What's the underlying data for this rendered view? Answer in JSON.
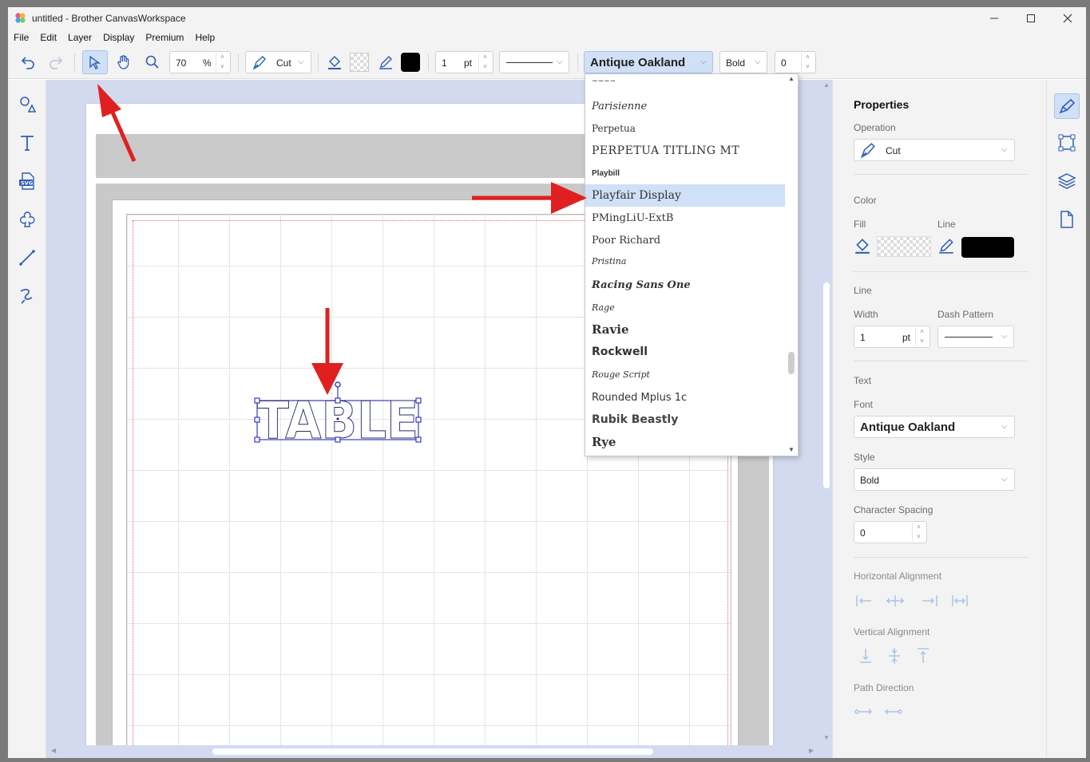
{
  "window": {
    "title": "untitled - Brother CanvasWorkspace"
  },
  "menu": [
    "File",
    "Edit",
    "Layer",
    "Display",
    "Premium",
    "Help"
  ],
  "toolbar": {
    "zoom_value": "70",
    "zoom_unit": "%",
    "operation": "Cut",
    "line_width": "1",
    "line_unit": "pt",
    "font": "Antique Oakland",
    "style": "Bold",
    "spacing": "0",
    "line_color": "#000000"
  },
  "canvas": {
    "text_object": "TABLE"
  },
  "font_list": {
    "selected": "Playfair Display",
    "items": [
      "Parisienne",
      "Perpetua",
      "PERPETUA TITLING MT",
      "Playbill",
      "Playfair Display",
      "PMingLiU-ExtB",
      "Poor Richard",
      "Pristina",
      "Racing Sans One",
      "Rage",
      "Ravie",
      "Rockwell",
      "Rouge Script",
      "Rounded Mplus 1c",
      "Rubik Beastly",
      "Rye"
    ]
  },
  "properties": {
    "title": "Properties",
    "operation_label": "Operation",
    "operation_value": "Cut",
    "color_label": "Color",
    "fill_label": "Fill",
    "line_label": "Line",
    "line_section": "Line",
    "width_label": "Width",
    "width_value": "1",
    "width_unit": "pt",
    "dash_label": "Dash Pattern",
    "text_section": "Text",
    "font_label": "Font",
    "font_value": "Antique Oakland",
    "style_label": "Style",
    "style_value": "Bold",
    "spacing_label": "Character Spacing",
    "spacing_value": "0",
    "halign_label": "Horizontal Alignment",
    "valign_label": "Vertical Alignment",
    "path_label": "Path Direction"
  },
  "colors": {
    "accent": "#2f5fb3",
    "annotation_arrow": "#e02020",
    "selection_highlight": "#cfe0f7"
  }
}
